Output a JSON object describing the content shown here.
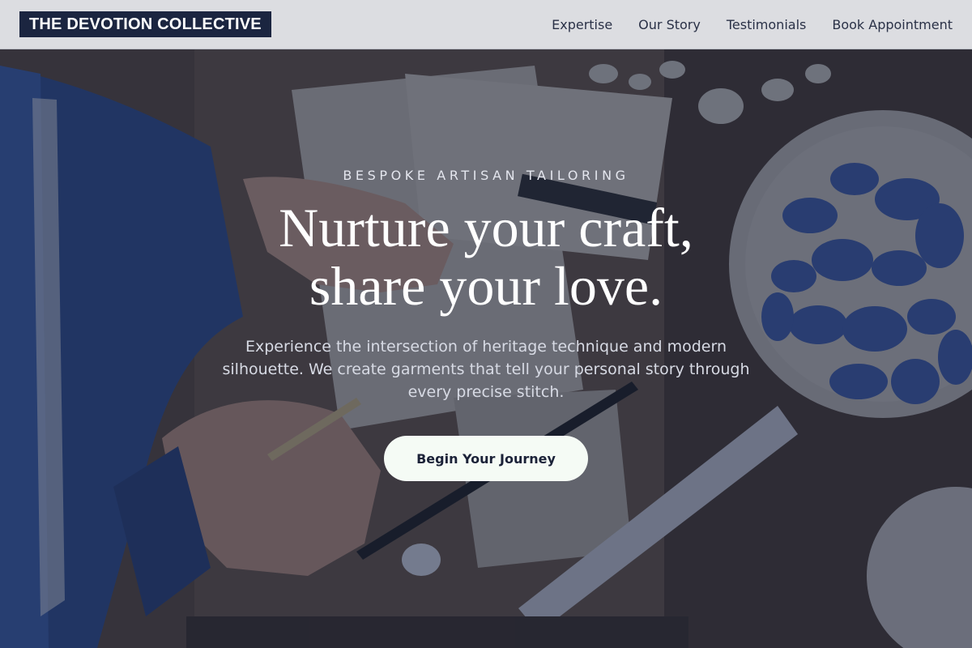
{
  "header": {
    "brand": "THE DEVOTION COLLECTIVE",
    "nav": [
      {
        "label": "Expertise"
      },
      {
        "label": "Our Story"
      },
      {
        "label": "Testimonials"
      },
      {
        "label": "Book Appointment"
      }
    ]
  },
  "hero": {
    "eyebrow": "BESPOKE ARTISAN TAILORING",
    "headline_line1": "Nurture your craft,",
    "headline_line2": "share your love.",
    "subtext": "Experience the intersection of heritage technique and modern silhouette. We create garments that tell your personal story through every precise stitch.",
    "cta_label": "Begin Your Journey"
  },
  "colors": {
    "brand_bg": "#1b2540",
    "header_bg": "#dcdde1",
    "overlay": "#18203a",
    "cta_bg": "#f5fbf5"
  }
}
